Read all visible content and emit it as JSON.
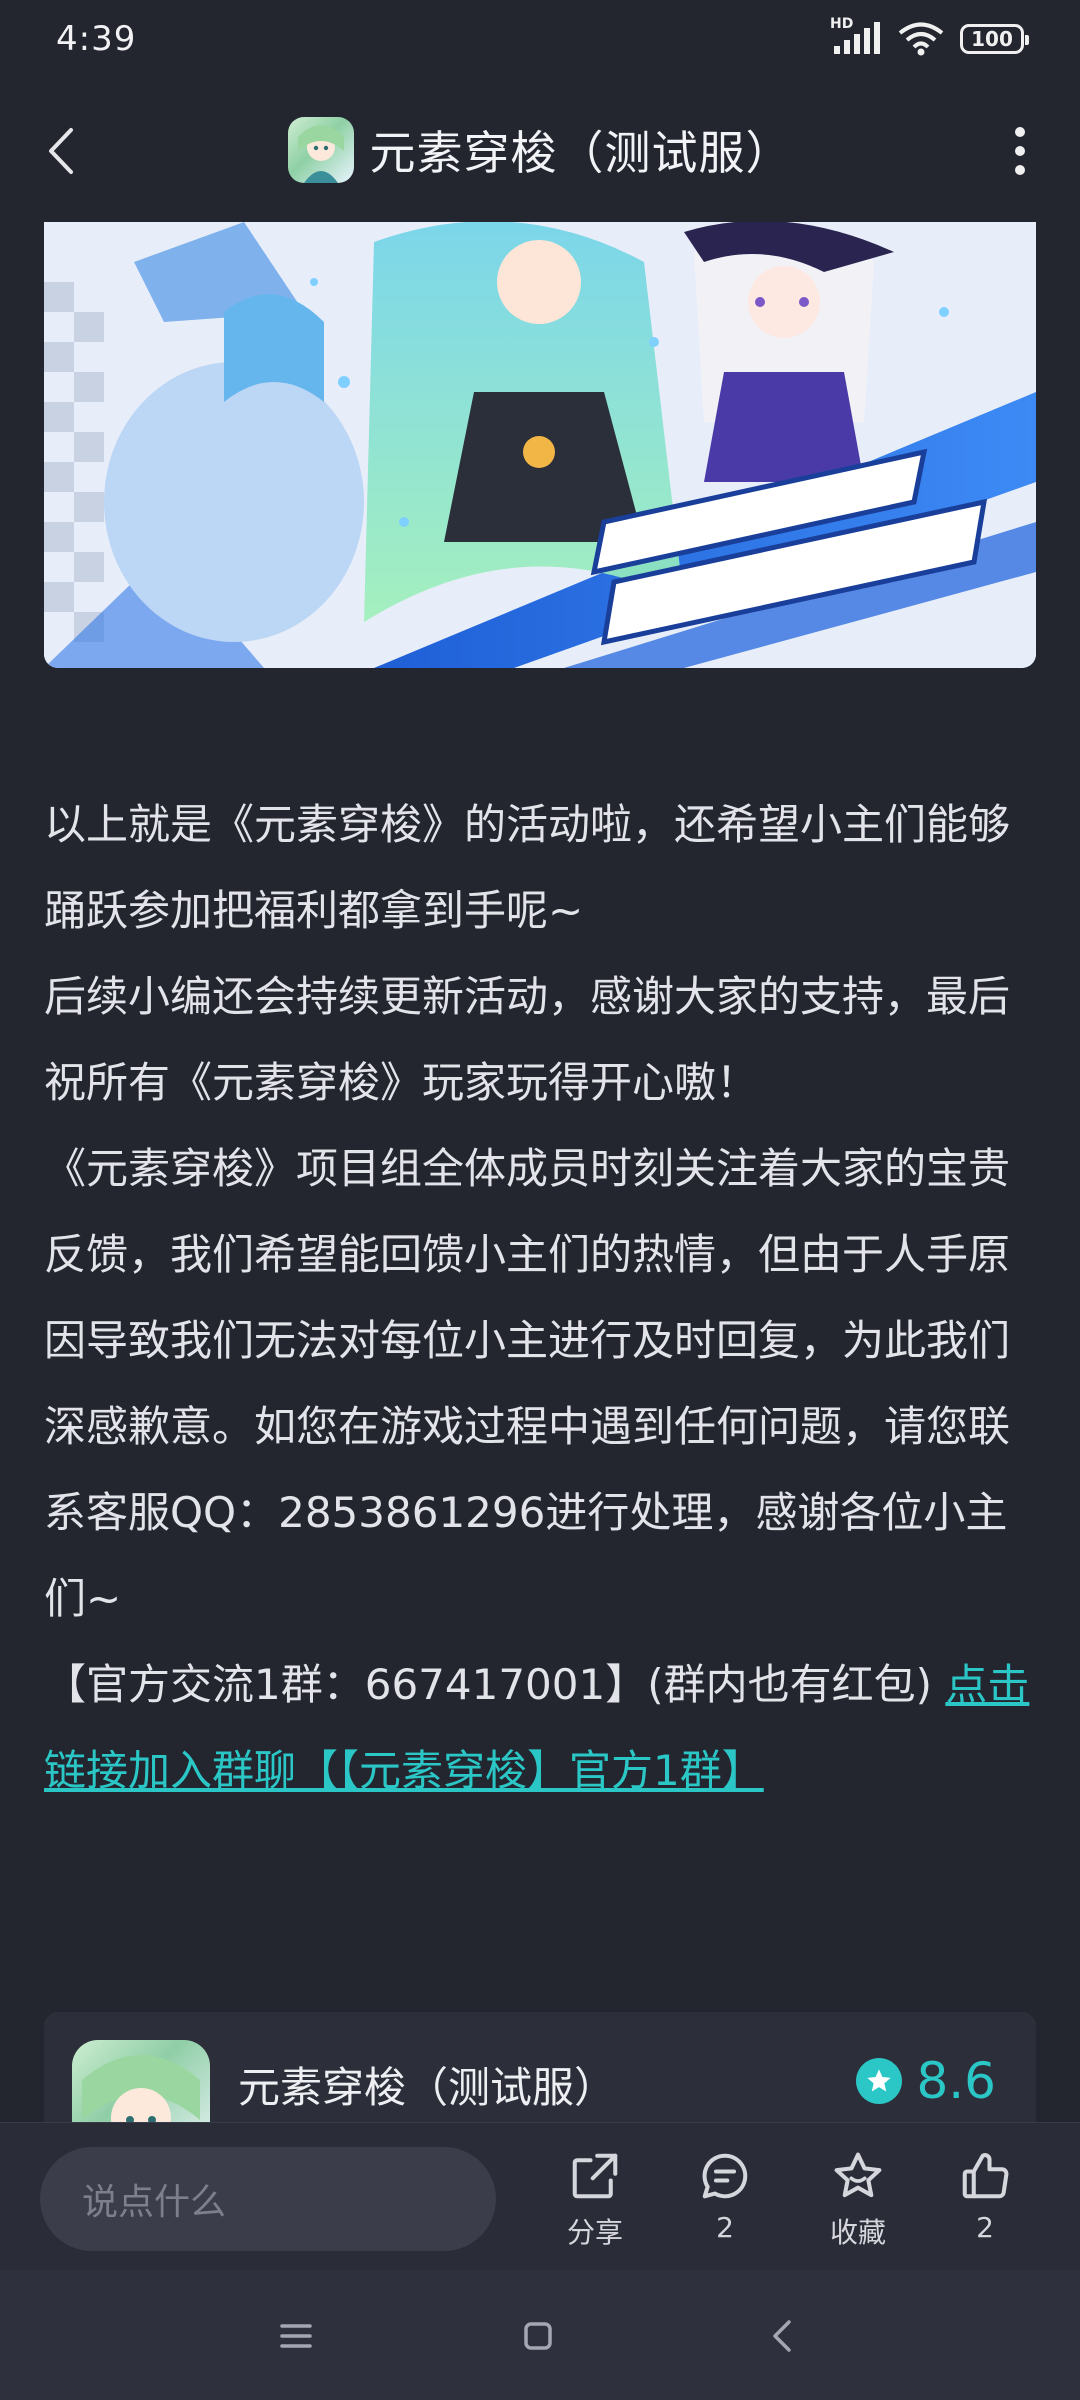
{
  "status": {
    "time": "4:39",
    "network": "HD",
    "battery": "100"
  },
  "header": {
    "title": "元素穿梭（测试服）"
  },
  "article": {
    "paragraphs": [
      "以上就是《元素穿梭》的活动啦，还希望小主们能够踊跃参加把福利都拿到手呢~",
      "后续小编还会持续更新活动，感谢大家的支持，最后祝所有《元素穿梭》玩家玩得开心嗷！",
      "《元素穿梭》项目组全体成员时刻关注着大家的宝贵反馈，我们希望能回馈小主们的热情，但由于人手原因导致我们无法对每位小主进行及时回复，为此我们深感歉意。如您在游戏过程中遇到任何问题，请您联系客服QQ：2853861296进行处理，感谢各位小主们~"
    ],
    "group_prefix": "【官方交流1群：667417001】(群内也有红包) ",
    "group_link": "点击链接加入群聊【【元素穿梭】官方1群】"
  },
  "game_card": {
    "name": "元素穿梭（测试服）",
    "rating": "8.6"
  },
  "action_bar": {
    "input_placeholder": "说点什么",
    "share_label": "分享",
    "comment_count": "2",
    "favorite_label": "收藏",
    "like_count": "2"
  },
  "colors": {
    "accent": "#2bc7c7",
    "background": "#23252f"
  }
}
